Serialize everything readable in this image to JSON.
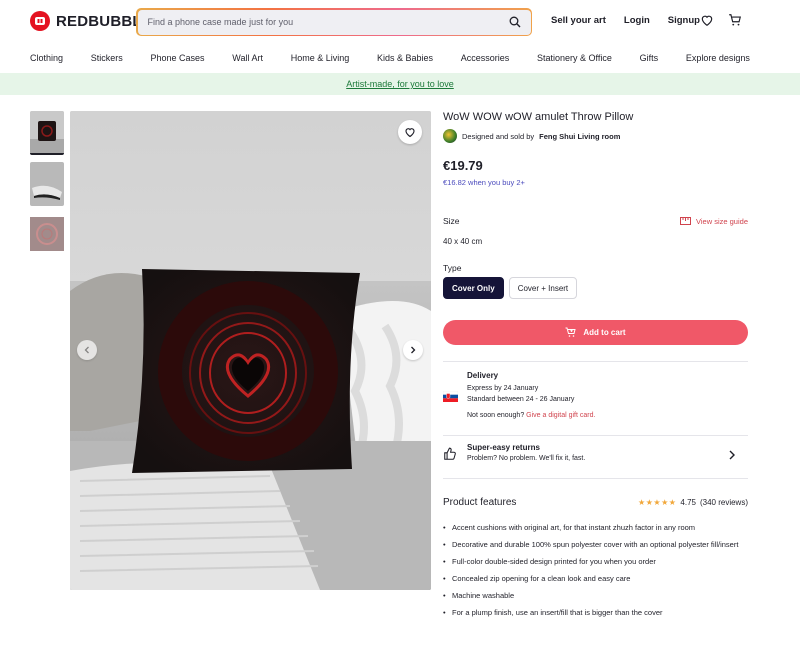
{
  "header": {
    "logo_text": "REDBUBBLE",
    "search_placeholder": "Find a phone case made just for you",
    "links": [
      "Sell your art",
      "Login",
      "Signup"
    ]
  },
  "nav": [
    "Clothing",
    "Stickers",
    "Phone Cases",
    "Wall Art",
    "Home & Living",
    "Kids & Babies",
    "Accessories",
    "Stationery & Office",
    "Gifts",
    "Explore designs"
  ],
  "banner": "Artist-made, for you to love",
  "product": {
    "title": "WoW WOW wOW amulet Throw Pillow",
    "designed_by": "Designed and sold by",
    "designer": "Feng Shui Living room",
    "price": "€19.79",
    "bulk_price": "€16.82 when you buy 2+",
    "size_label": "Size",
    "size_guide": "View size guide",
    "size_value": "40 x 40 cm",
    "type_label": "Type",
    "type_options": [
      "Cover Only",
      "Cover + Insert"
    ],
    "add_to_cart": "Add to cart"
  },
  "delivery": {
    "heading": "Delivery",
    "express": "Express by 24 January",
    "standard": "Standard between 24 - 26 January",
    "not_soon": "Not soon enough?",
    "gift_card": "Give a digital gift card."
  },
  "returns": {
    "heading": "Super-easy returns",
    "sub": "Problem? No problem. We'll fix it, fast."
  },
  "features": {
    "heading": "Product features",
    "rating": "4.75",
    "reviews": "(340 reviews)",
    "items": [
      "Accent cushions with original art, for that instant zhuzh factor in any room",
      "Decorative and durable 100% spun polyester cover with an optional polyester fill/insert",
      "Full-color double-sided design printed for you when you order",
      "Concealed zip opening for a clean look and easy care",
      "Machine washable",
      "For a plump finish, use an insert/fill that is bigger than the cover"
    ]
  },
  "colors": {
    "brand": "#e41321",
    "cart": "#f05868",
    "selected": "#151438",
    "accent_red": "#d0434d"
  }
}
